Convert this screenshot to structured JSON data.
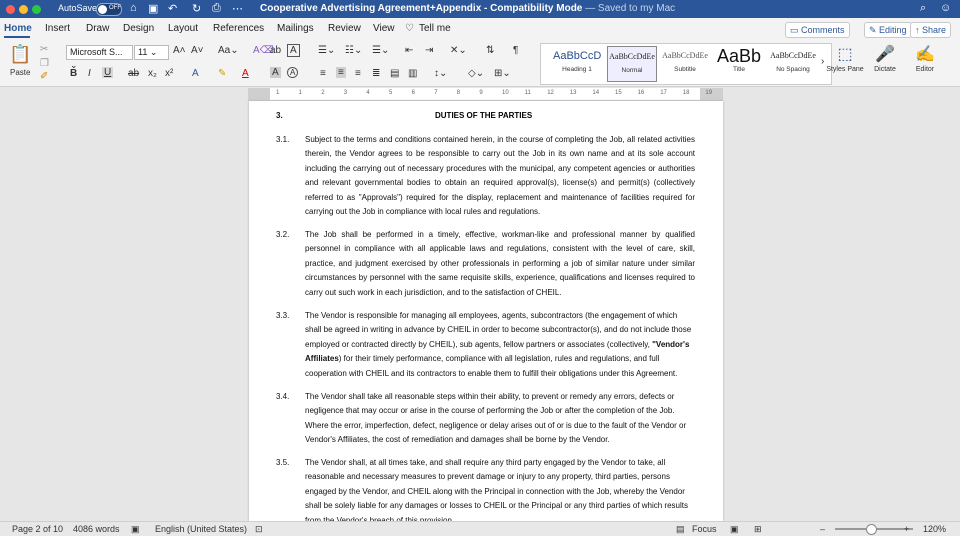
{
  "titlebar": {
    "autosave_label": "AutoSave",
    "autosave_state": "OFF",
    "title": "Cooperative Advertising Agreement+Appendix  -  Compatibility Mode",
    "saved_status": "— Saved to my Mac"
  },
  "tabs": [
    "Home",
    "Insert",
    "Draw",
    "Design",
    "Layout",
    "References",
    "Mailings",
    "Review",
    "View"
  ],
  "tell_me": "Tell me",
  "top_buttons": {
    "comments": "Comments",
    "editing": "Editing",
    "share": "Share"
  },
  "ribbon": {
    "paste_label": "Paste",
    "font_name": "Microsoft S...",
    "font_size": "11",
    "styles": [
      {
        "sample": "AaBbCcD",
        "name": "Heading 1"
      },
      {
        "sample": "AaBbCcDdEe",
        "name": "Normal"
      },
      {
        "sample": "AaBbCcDdEe",
        "name": "Subtitle"
      },
      {
        "sample": "AaBb",
        "name": "Title"
      },
      {
        "sample": "AaBbCcDdEe",
        "name": "No Spacing"
      }
    ],
    "styles_pane_label": "Styles Pane",
    "dictate_label": "Dictate",
    "editor_label": "Editor"
  },
  "ruler_numbers": [
    "1",
    "1",
    "2",
    "3",
    "4",
    "5",
    "6",
    "7",
    "8",
    "9",
    "10",
    "11",
    "12",
    "13",
    "14",
    "15",
    "16",
    "17",
    "18",
    "19"
  ],
  "document": {
    "section_number": "3.",
    "section_title": "DUTIES OF THE PARTIES",
    "clauses": [
      {
        "num": "3.1.",
        "text": "Subject to the terms and conditions contained herein, in the course of completing the Job, all related activities therein, the Vendor agrees to be responsible to carry out the Job in its own name and at its sole account including the carrying out of necessary procedures with the municipal, any competent agencies or authorities and relevant governmental bodies to obtain an required approval(s), license(s) and permit(s) (collectively referred to as \"Approvals\") required for the display, replacement and maintenance of facilities required for carrying out the Job in compliance with local rules and regulations."
      },
      {
        "num": "3.2.",
        "text": "The Job shall be performed in a timely, effective, workman-like and professional manner by qualified personnel in compliance with all applicable laws and regulations, consistent with the level of care, skill, practice, and judgment exercised by other professionals in performing a job of similar nature under similar circumstances by personnel with the same requisite skills, experience, qualifications and licenses required to carry out such work in each jurisdiction, and to the satisfaction of CHEIL."
      },
      {
        "num": "3.3.",
        "text_before": " The Vendor is responsible for managing all employees, agents, subcontractors (the engagement of which shall be agreed in writing in advance by CHEIL in order to become subcontractor(s), and do not include those employed or contracted directly by CHEIL), sub agents, fellow partners or associates (collectively, ",
        "bold": "\"Vendor's Affiliates",
        "text_after": ") for their timely performance, compliance with all legislation, rules and regulations, and full cooperation with CHEIL and its contractors to enable them to fulfill their obligations under this Agreement."
      },
      {
        "num": "3.4.",
        "text": "The Vendor shall take all reasonable steps within their ability, to prevent or remedy any errors, defects or negligence that may occur or arise in the course of performing the Job or after the completion of the Job. Where the error, imperfection, defect, negligence or delay arises out of or is due to the fault of the Vendor or Vendor's Affiliates, the cost of remediation and damages shall be borne by the Vendor."
      },
      {
        "num": "3.5.",
        "text": "The Vendor shall, at all times take, and shall require any third party engaged by the Vendor to take, all reasonable and necessary measures to prevent damage or injury to any property, third parties, persons engaged by the Vendor, and CHEIL along with the Principal in connection with the Job, whereby the Vendor shall be solely liable for any damages or losses to CHEIL or the Principal or any third parties of which results from the Vendor's breach of this provision."
      }
    ]
  },
  "status": {
    "page": "Page 2 of 10",
    "words": "4086 words",
    "language": "English (United States)",
    "focus": "Focus",
    "zoom": "120%"
  }
}
